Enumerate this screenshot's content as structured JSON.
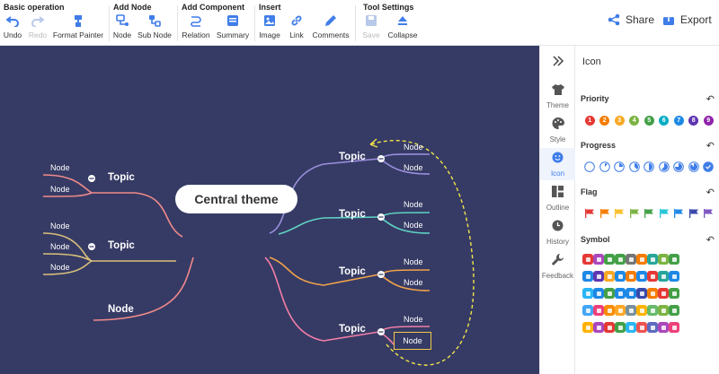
{
  "toolbar": {
    "groups": [
      {
        "title": "Basic operation",
        "buttons": [
          {
            "label": "Undo",
            "icon": "undo-icon",
            "disabled": false
          },
          {
            "label": "Redo",
            "icon": "redo-icon",
            "disabled": true
          },
          {
            "label": "Format Painter",
            "icon": "format-painter-icon",
            "disabled": false
          }
        ]
      },
      {
        "title": "Add Node",
        "buttons": [
          {
            "label": "Node",
            "icon": "node-icon",
            "disabled": false
          },
          {
            "label": "Sub Node",
            "icon": "sub-node-icon",
            "disabled": false
          }
        ]
      },
      {
        "title": "Add Component",
        "buttons": [
          {
            "label": "Relation",
            "icon": "relation-icon",
            "disabled": false
          },
          {
            "label": "Summary",
            "icon": "summary-icon",
            "disabled": false
          }
        ]
      },
      {
        "title": "Insert",
        "buttons": [
          {
            "label": "Image",
            "icon": "image-icon",
            "disabled": false
          },
          {
            "label": "Link",
            "icon": "link-icon",
            "disabled": false
          },
          {
            "label": "Comments",
            "icon": "comments-icon",
            "disabled": false
          }
        ]
      },
      {
        "title": "Tool Settings",
        "buttons": [
          {
            "label": "Save",
            "icon": "save-icon",
            "disabled": true
          },
          {
            "label": "Collapse",
            "icon": "collapse-icon",
            "disabled": false
          }
        ]
      }
    ],
    "share_label": "Share",
    "export_label": "Export"
  },
  "mindmap": {
    "central": "Central theme",
    "topics": [
      {
        "label": "Topic",
        "nodes": [
          "Node",
          "Node"
        ]
      },
      {
        "label": "Topic",
        "nodes": [
          "Node",
          "Node"
        ]
      },
      {
        "label": "Topic",
        "nodes": [
          "Node",
          "Node"
        ]
      },
      {
        "label": "Topic",
        "nodes": [
          "Node",
          "Node"
        ]
      },
      {
        "label": "Topic",
        "nodes": [
          "Node",
          "Node"
        ]
      },
      {
        "label": "Topic",
        "nodes": [
          "Node",
          "Node",
          "Node"
        ]
      }
    ],
    "floating_node": "Node",
    "colors": {
      "bg": "#363b65",
      "purple": "#9a8fdc",
      "teal": "#5fd3c3",
      "orange": "#f0a24a",
      "pink": "#f07ea6",
      "salmon": "#f08a8a",
      "khaki": "#d9c07a",
      "relation": "#f2e34a"
    }
  },
  "sidebar": {
    "tabs": [
      {
        "label": "Theme",
        "icon": "shirt-icon"
      },
      {
        "label": "Style",
        "icon": "palette-icon"
      },
      {
        "label": "Icon",
        "icon": "smiley-icon",
        "active": true
      },
      {
        "label": "Outline",
        "icon": "outline-icon"
      },
      {
        "label": "History",
        "icon": "clock-icon"
      },
      {
        "label": "Feedback",
        "icon": "wrench-icon"
      }
    ]
  },
  "panel": {
    "title": "Icon",
    "sections": [
      {
        "title": "Priority"
      },
      {
        "title": "Progress"
      },
      {
        "title": "Flag"
      },
      {
        "title": "Symbol"
      }
    ],
    "priority": [
      "1",
      "2",
      "3",
      "4",
      "5",
      "6",
      "7",
      "8",
      "9"
    ],
    "priority_colors": [
      "#e53935",
      "#f57c00",
      "#f9a825",
      "#7cb342",
      "#43a047",
      "#00acc1",
      "#1e88e5",
      "#5e35b1",
      "#8e24aa"
    ],
    "progress": [
      0,
      0.125,
      0.25,
      0.375,
      0.5,
      0.625,
      0.75,
      0.875,
      1
    ],
    "flag_colors": [
      "#e53935",
      "#f57c00",
      "#fbc02d",
      "#7cb342",
      "#43a047",
      "#26c6da",
      "#1e88e5",
      "#3949ab",
      "#7e57c2"
    ],
    "symbol_colors": [
      [
        "#e53935",
        "#ab47bc",
        "#43a047",
        "#43a047",
        "#757575",
        "#f57c00",
        "#26a69a",
        "#7cb342",
        "#43a047"
      ],
      [
        "#1e88e5",
        "#5e35b1",
        "#f9a825",
        "#1e88e5",
        "#f57c00",
        "#1e88e5",
        "#e53935",
        "#26a69a",
        "#1e88e5"
      ],
      [
        "#29b6f6",
        "#1e88e5",
        "#43a047",
        "#1e88e5",
        "#1e88e5",
        "#3949ab",
        "#f57c00",
        "#e53935",
        "#43a047"
      ],
      [
        "#42a5f5",
        "#ec407a",
        "#fb8c00",
        "#ffa726",
        "#78909c",
        "#ffb300",
        "#66bb6a",
        "#7cb342",
        "#43a047"
      ],
      [
        "#ffb300",
        "#ab47bc",
        "#e53935",
        "#43a047",
        "#29b6f6",
        "#ef5350",
        "#5c6bc0",
        "#ab47bc",
        "#ec407a"
      ]
    ]
  }
}
